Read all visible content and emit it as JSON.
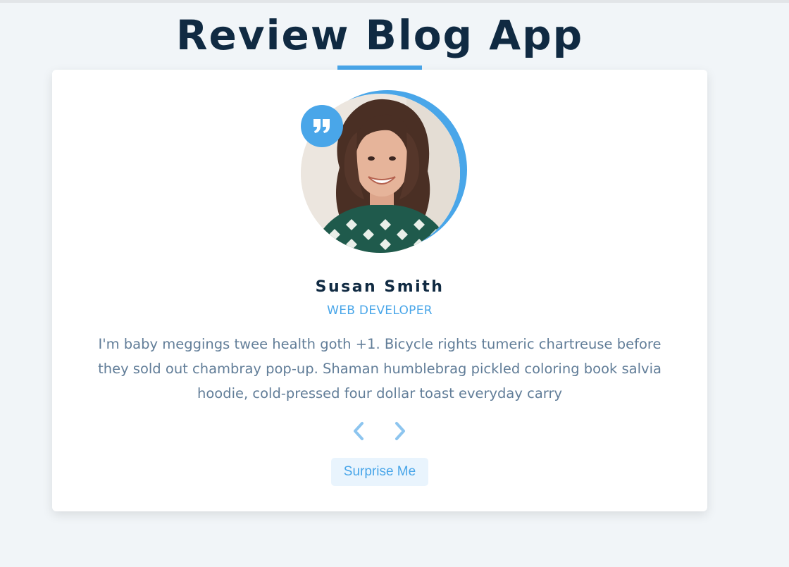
{
  "page": {
    "title": "Review Blog App"
  },
  "review": {
    "name": "Susan Smith",
    "job": "WEB DEVELOPER",
    "text": "I'm baby meggings twee health goth +1. Bicycle rights tumeric chartreuse before they sold out chambray pop-up. Shaman humblebrag pickled coloring book salvia hoodie, cold-pressed four dollar toast everyday carry",
    "image_alt": "Susan Smith"
  },
  "controls": {
    "prev_icon": "chevron-left-icon",
    "next_icon": "chevron-right-icon",
    "surprise_label": "Surprise Me"
  },
  "colors": {
    "primary": "#49a6e9",
    "primary_light": "#e9f4fd",
    "heading": "#102a42",
    "text": "#617d98",
    "background": "#f1f5f8"
  }
}
